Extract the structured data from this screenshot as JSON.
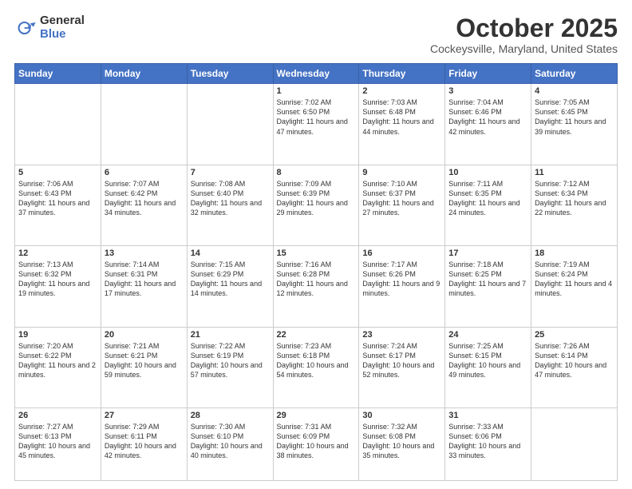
{
  "logo": {
    "general": "General",
    "blue": "Blue"
  },
  "title": {
    "month": "October 2025",
    "location": "Cockeysville, Maryland, United States"
  },
  "headers": [
    "Sunday",
    "Monday",
    "Tuesday",
    "Wednesday",
    "Thursday",
    "Friday",
    "Saturday"
  ],
  "weeks": [
    [
      {
        "day": "",
        "info": "",
        "empty": true
      },
      {
        "day": "",
        "info": "",
        "empty": true
      },
      {
        "day": "",
        "info": "",
        "empty": true
      },
      {
        "day": "1",
        "info": "Sunrise: 7:02 AM\nSunset: 6:50 PM\nDaylight: 11 hours and 47 minutes."
      },
      {
        "day": "2",
        "info": "Sunrise: 7:03 AM\nSunset: 6:48 PM\nDaylight: 11 hours and 44 minutes."
      },
      {
        "day": "3",
        "info": "Sunrise: 7:04 AM\nSunset: 6:46 PM\nDaylight: 11 hours and 42 minutes."
      },
      {
        "day": "4",
        "info": "Sunrise: 7:05 AM\nSunset: 6:45 PM\nDaylight: 11 hours and 39 minutes."
      }
    ],
    [
      {
        "day": "5",
        "info": "Sunrise: 7:06 AM\nSunset: 6:43 PM\nDaylight: 11 hours and 37 minutes."
      },
      {
        "day": "6",
        "info": "Sunrise: 7:07 AM\nSunset: 6:42 PM\nDaylight: 11 hours and 34 minutes."
      },
      {
        "day": "7",
        "info": "Sunrise: 7:08 AM\nSunset: 6:40 PM\nDaylight: 11 hours and 32 minutes."
      },
      {
        "day": "8",
        "info": "Sunrise: 7:09 AM\nSunset: 6:39 PM\nDaylight: 11 hours and 29 minutes."
      },
      {
        "day": "9",
        "info": "Sunrise: 7:10 AM\nSunset: 6:37 PM\nDaylight: 11 hours and 27 minutes."
      },
      {
        "day": "10",
        "info": "Sunrise: 7:11 AM\nSunset: 6:35 PM\nDaylight: 11 hours and 24 minutes."
      },
      {
        "day": "11",
        "info": "Sunrise: 7:12 AM\nSunset: 6:34 PM\nDaylight: 11 hours and 22 minutes."
      }
    ],
    [
      {
        "day": "12",
        "info": "Sunrise: 7:13 AM\nSunset: 6:32 PM\nDaylight: 11 hours and 19 minutes."
      },
      {
        "day": "13",
        "info": "Sunrise: 7:14 AM\nSunset: 6:31 PM\nDaylight: 11 hours and 17 minutes."
      },
      {
        "day": "14",
        "info": "Sunrise: 7:15 AM\nSunset: 6:29 PM\nDaylight: 11 hours and 14 minutes."
      },
      {
        "day": "15",
        "info": "Sunrise: 7:16 AM\nSunset: 6:28 PM\nDaylight: 11 hours and 12 minutes."
      },
      {
        "day": "16",
        "info": "Sunrise: 7:17 AM\nSunset: 6:26 PM\nDaylight: 11 hours and 9 minutes."
      },
      {
        "day": "17",
        "info": "Sunrise: 7:18 AM\nSunset: 6:25 PM\nDaylight: 11 hours and 7 minutes."
      },
      {
        "day": "18",
        "info": "Sunrise: 7:19 AM\nSunset: 6:24 PM\nDaylight: 11 hours and 4 minutes."
      }
    ],
    [
      {
        "day": "19",
        "info": "Sunrise: 7:20 AM\nSunset: 6:22 PM\nDaylight: 11 hours and 2 minutes."
      },
      {
        "day": "20",
        "info": "Sunrise: 7:21 AM\nSunset: 6:21 PM\nDaylight: 10 hours and 59 minutes."
      },
      {
        "day": "21",
        "info": "Sunrise: 7:22 AM\nSunset: 6:19 PM\nDaylight: 10 hours and 57 minutes."
      },
      {
        "day": "22",
        "info": "Sunrise: 7:23 AM\nSunset: 6:18 PM\nDaylight: 10 hours and 54 minutes."
      },
      {
        "day": "23",
        "info": "Sunrise: 7:24 AM\nSunset: 6:17 PM\nDaylight: 10 hours and 52 minutes."
      },
      {
        "day": "24",
        "info": "Sunrise: 7:25 AM\nSunset: 6:15 PM\nDaylight: 10 hours and 49 minutes."
      },
      {
        "day": "25",
        "info": "Sunrise: 7:26 AM\nSunset: 6:14 PM\nDaylight: 10 hours and 47 minutes."
      }
    ],
    [
      {
        "day": "26",
        "info": "Sunrise: 7:27 AM\nSunset: 6:13 PM\nDaylight: 10 hours and 45 minutes."
      },
      {
        "day": "27",
        "info": "Sunrise: 7:29 AM\nSunset: 6:11 PM\nDaylight: 10 hours and 42 minutes."
      },
      {
        "day": "28",
        "info": "Sunrise: 7:30 AM\nSunset: 6:10 PM\nDaylight: 10 hours and 40 minutes."
      },
      {
        "day": "29",
        "info": "Sunrise: 7:31 AM\nSunset: 6:09 PM\nDaylight: 10 hours and 38 minutes."
      },
      {
        "day": "30",
        "info": "Sunrise: 7:32 AM\nSunset: 6:08 PM\nDaylight: 10 hours and 35 minutes."
      },
      {
        "day": "31",
        "info": "Sunrise: 7:33 AM\nSunset: 6:06 PM\nDaylight: 10 hours and 33 minutes."
      },
      {
        "day": "",
        "info": "",
        "empty": true
      }
    ]
  ]
}
